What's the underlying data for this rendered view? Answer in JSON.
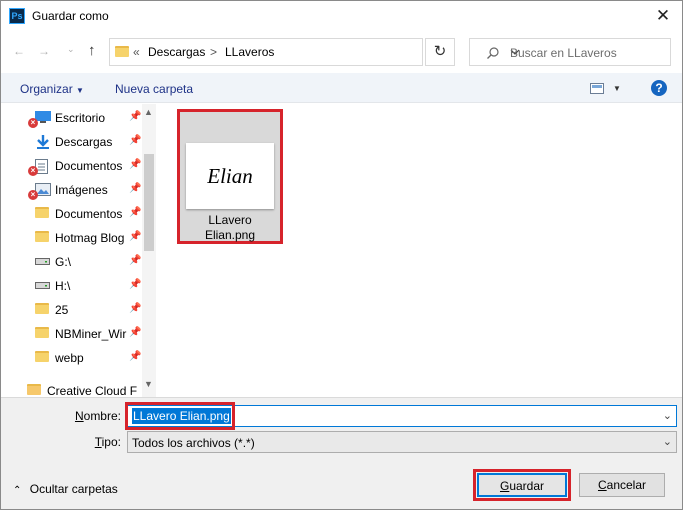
{
  "window": {
    "title": "Guardar como"
  },
  "address": {
    "overflow": "«",
    "crumbs": [
      "Descargas",
      "LLaveros"
    ],
    "separator": ">"
  },
  "search": {
    "placeholder": "Buscar en LLaveros"
  },
  "toolbar": {
    "organize": "Organizar",
    "new_folder": "Nueva carpeta",
    "help": "?"
  },
  "sidebar": {
    "items": [
      {
        "label": "Escritorio",
        "icon": "desktop-icon",
        "pinned": true,
        "sync_error": true
      },
      {
        "label": "Descargas",
        "icon": "download-icon",
        "pinned": true,
        "sync_error": false
      },
      {
        "label": "Documentos",
        "icon": "document-icon",
        "pinned": true,
        "sync_error": true
      },
      {
        "label": "Imágenes",
        "icon": "picture-icon",
        "pinned": true,
        "sync_error": true
      },
      {
        "label": "Documentos",
        "icon": "folder-icon",
        "pinned": true,
        "sync_error": false
      },
      {
        "label": "Hotmag Blog",
        "icon": "folder-icon",
        "pinned": true,
        "sync_error": false
      },
      {
        "label": "G:\\",
        "icon": "drive-icon",
        "pinned": true,
        "sync_error": false
      },
      {
        "label": "H:\\",
        "icon": "drive-icon",
        "pinned": true,
        "sync_error": false
      },
      {
        "label": "25",
        "icon": "folder-icon",
        "pinned": true,
        "sync_error": false
      },
      {
        "label": "NBMiner_Wir",
        "icon": "folder-icon",
        "pinned": true,
        "sync_error": false
      },
      {
        "label": "webp",
        "icon": "folder-icon",
        "pinned": true,
        "sync_error": false
      },
      {
        "label": "Creative Cloud Fil",
        "icon": "creative-cloud-folder-icon",
        "pinned": false,
        "sync_error": false
      }
    ]
  },
  "files": [
    {
      "name_line1": "LLavero",
      "name_line2": "Elian.png",
      "thumbnail_text": "Elian",
      "selected": true
    }
  ],
  "form": {
    "filename_label_prefix": "N",
    "filename_label_rest": "ombre:",
    "filename_value": "LLavero Elian.png",
    "type_label_prefix": "T",
    "type_label_rest": "ipo:",
    "type_value": "Todos los archivos (*.*)"
  },
  "footer": {
    "hide_folders": "Ocultar carpetas",
    "save_prefix": "G",
    "save_rest": "uardar",
    "cancel_prefix": "C",
    "cancel_rest": "ancelar"
  },
  "colors": {
    "accent": "#0078d7",
    "highlight": "#d6232b",
    "folder": "#f6d36b"
  }
}
